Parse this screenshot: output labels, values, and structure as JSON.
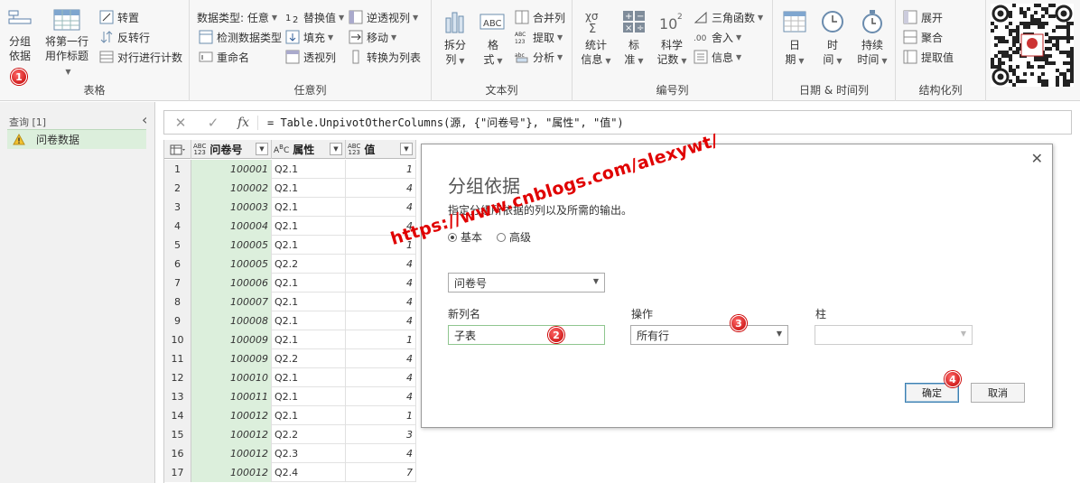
{
  "ribbon": {
    "groups": {
      "table": {
        "label": "表格",
        "group_by": [
          "分组",
          "依据"
        ],
        "first_row_header": [
          "将第一行",
          "用作标题"
        ],
        "transpose": "转置",
        "reverse_rows": "反转行",
        "count_rows": "对行进行计数"
      },
      "any_column": {
        "label": "任意列",
        "data_type": "数据类型: 任意",
        "detect_type": "检测数据类型",
        "rename": "重命名",
        "replace_values": "替换值",
        "fill": "填充",
        "pivot": "透视列",
        "unpivot": "逆透视列",
        "move": "移动",
        "convert_to_list": "转换为列表"
      },
      "text_column": {
        "label": "文本列",
        "split": [
          "拆分",
          "列"
        ],
        "format": [
          "格",
          "式"
        ],
        "merge": "合并列",
        "extract": "提取",
        "parse": "分析"
      },
      "number_column": {
        "label": "编号列",
        "statistics": [
          "统计",
          "信息"
        ],
        "standard": [
          "标",
          "准"
        ],
        "scientific": [
          "科学",
          "记数"
        ],
        "trig": "三角函数",
        "rounding": "舍入",
        "information": "信息"
      },
      "datetime_column": {
        "label": "日期 & 时间列",
        "date": [
          "日",
          "期"
        ],
        "time": [
          "时",
          "间"
        ],
        "duration": [
          "持续",
          "时间"
        ]
      },
      "structured_column": {
        "label": "结构化列",
        "expand": "展开",
        "aggregate": "聚合",
        "extract_values": "提取值"
      }
    }
  },
  "query_pane": {
    "title": "查询 [1]",
    "item": "问卷数据"
  },
  "formula": "= Table.UnpivotOtherColumns(源, {\"问卷号\"}, \"属性\", \"值\")",
  "grid": {
    "headers": {
      "id": "问卷号",
      "attr": "属性",
      "val": "值"
    },
    "badges": {
      "id": [
        "ABC",
        "123"
      ],
      "attr": [
        "A",
        "B",
        "C"
      ],
      "val": [
        "ABC",
        "123"
      ]
    },
    "rows": [
      {
        "idx": "1",
        "id": "100001",
        "attr": "Q2.1",
        "val": "1"
      },
      {
        "idx": "2",
        "id": "100002",
        "attr": "Q2.1",
        "val": "4"
      },
      {
        "idx": "3",
        "id": "100003",
        "attr": "Q2.1",
        "val": "4"
      },
      {
        "idx": "4",
        "id": "100004",
        "attr": "Q2.1",
        "val": "4"
      },
      {
        "idx": "5",
        "id": "100005",
        "attr": "Q2.1",
        "val": "1"
      },
      {
        "idx": "6",
        "id": "100005",
        "attr": "Q2.2",
        "val": "4"
      },
      {
        "idx": "7",
        "id": "100006",
        "attr": "Q2.1",
        "val": "4"
      },
      {
        "idx": "8",
        "id": "100007",
        "attr": "Q2.1",
        "val": "4"
      },
      {
        "idx": "9",
        "id": "100008",
        "attr": "Q2.1",
        "val": "4"
      },
      {
        "idx": "10",
        "id": "100009",
        "attr": "Q2.1",
        "val": "1"
      },
      {
        "idx": "11",
        "id": "100009",
        "attr": "Q2.2",
        "val": "4"
      },
      {
        "idx": "12",
        "id": "100010",
        "attr": "Q2.1",
        "val": "4"
      },
      {
        "idx": "13",
        "id": "100011",
        "attr": "Q2.1",
        "val": "4"
      },
      {
        "idx": "14",
        "id": "100012",
        "attr": "Q2.1",
        "val": "1"
      },
      {
        "idx": "15",
        "id": "100012",
        "attr": "Q2.2",
        "val": "3"
      },
      {
        "idx": "16",
        "id": "100012",
        "attr": "Q2.3",
        "val": "4"
      },
      {
        "idx": "17",
        "id": "100012",
        "attr": "Q2.4",
        "val": "7"
      }
    ]
  },
  "dialog": {
    "title": "分组依据",
    "description": "指定分组所依据的列以及所需的输出。",
    "radio_basic": "基本",
    "radio_advanced": "高级",
    "group_column": "问卷号",
    "new_column_label": "新列名",
    "new_column_value": "子表",
    "operation_label": "操作",
    "operation_value": "所有行",
    "column_label": "柱",
    "column_value": "",
    "ok": "确定",
    "cancel": "取消"
  },
  "annotations": {
    "markers": [
      "1",
      "2",
      "3",
      "4"
    ],
    "watermark": "https://www.cnblogs.com/alexywt/",
    "color": "#e00000"
  },
  "icons": [
    "group-by-icon",
    "table-header-icon",
    "transpose-icon",
    "reverse-rows-icon",
    "count-rows-icon",
    "detect-type-icon",
    "rename-icon",
    "replace-icon",
    "fill-down-icon",
    "pivot-icon",
    "unpivot-icon",
    "move-icon",
    "convert-list-icon",
    "split-column-icon",
    "format-icon",
    "merge-columns-icon",
    "extract-icon",
    "parse-icon",
    "statistics-icon",
    "standard-icon",
    "scientific-icon",
    "trig-icon",
    "rounding-icon",
    "info-icon",
    "date-icon",
    "time-icon",
    "duration-icon",
    "expand-icon",
    "aggregate-icon",
    "extract-values-icon",
    "qr-code-icon",
    "warning-icon",
    "close-icon",
    "collapse-icon"
  ]
}
